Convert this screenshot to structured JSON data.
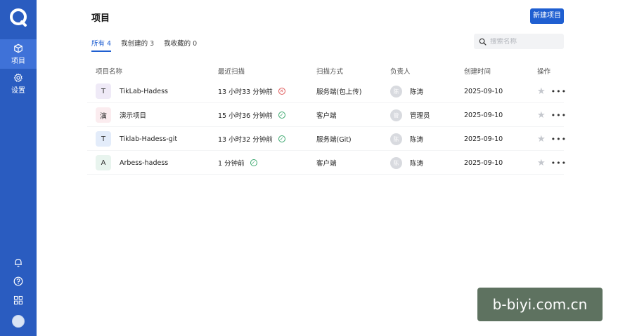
{
  "sidebar": {
    "nav": [
      {
        "label": "项目",
        "icon": "cube-icon",
        "active": true
      },
      {
        "label": "设置",
        "icon": "gear-icon",
        "active": false
      }
    ],
    "bottom_icons": [
      "bell-icon",
      "help-icon",
      "apps-grid-icon"
    ]
  },
  "header": {
    "title": "项目",
    "new_button": "新建项目"
  },
  "tabs": [
    {
      "label": "所有",
      "count": "4",
      "active": true
    },
    {
      "label": "我创建的",
      "count": "3",
      "active": false
    },
    {
      "label": "我收藏的",
      "count": "0",
      "active": false
    }
  ],
  "search": {
    "placeholder": "搜索名称"
  },
  "table": {
    "columns": [
      "项目名称",
      "最近扫描",
      "扫描方式",
      "负责人",
      "创建时间",
      "操作"
    ],
    "rows": [
      {
        "icon_letter": "T",
        "icon_bg": "#efeaf7",
        "icon_color": "#333",
        "name": "TikLab-Hadess",
        "last_scan": "13 小时33 分钟前",
        "scan_status": "error",
        "method": "服务端(包上传)",
        "owner_avatar": "陈",
        "owner": "陈涛",
        "created": "2025-09-10"
      },
      {
        "icon_letter": "演",
        "icon_bg": "#fbecef",
        "icon_color": "#333",
        "name": "演示项目",
        "last_scan": "15 小时36 分钟前",
        "scan_status": "ok",
        "method": "客户端",
        "owner_avatar": "管",
        "owner": "管理员",
        "created": "2025-09-10"
      },
      {
        "icon_letter": "T",
        "icon_bg": "#e3ecfa",
        "icon_color": "#333",
        "name": "Tiklab-Hadess-git",
        "last_scan": "13 小时32 分钟前",
        "scan_status": "ok",
        "method": "服务端(Git)",
        "owner_avatar": "陈",
        "owner": "陈涛",
        "created": "2025-09-10"
      },
      {
        "icon_letter": "A",
        "icon_bg": "#e8f4ee",
        "icon_color": "#333",
        "name": "Arbess-hadess",
        "last_scan": "1 分钟前",
        "scan_status": "ok",
        "method": "客户端",
        "owner_avatar": "陈",
        "owner": "陈涛",
        "created": "2025-09-10"
      }
    ]
  },
  "watermark": "b-biyi.com.cn",
  "colors": {
    "sidebar": "#2a5cc0",
    "accent": "#1f5fd1",
    "ok": "#3aa76d",
    "error": "#e05a5a"
  }
}
